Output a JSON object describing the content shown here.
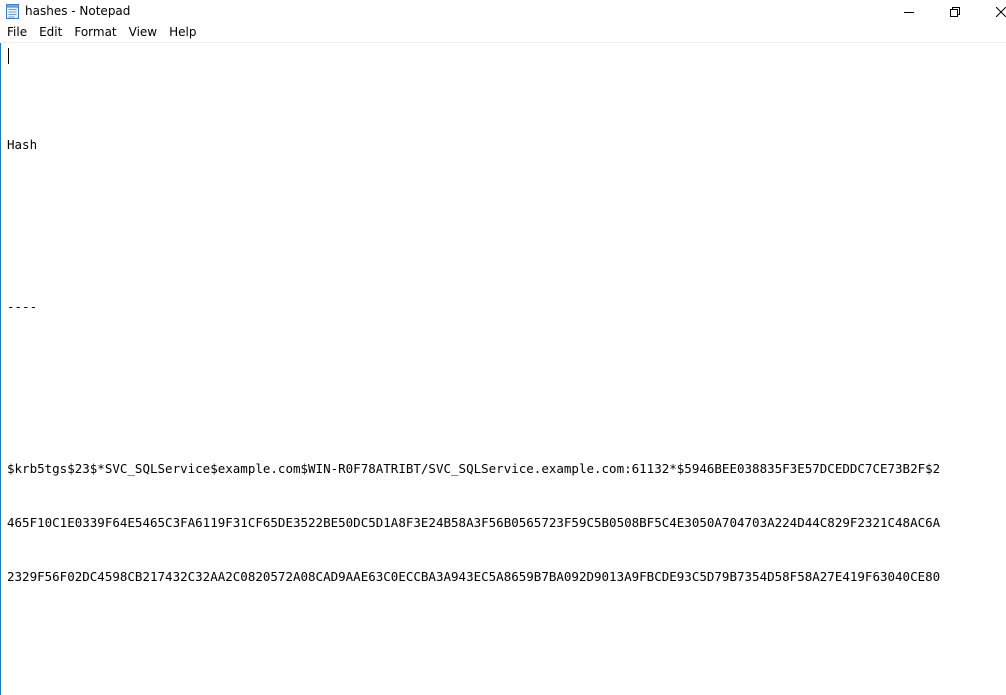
{
  "window": {
    "title": "hashes - Notepad",
    "accent_color": "#1979ca"
  },
  "icons": {
    "app": "notepad-icon",
    "minimize": "minimize-icon",
    "maximize": "restore-icon",
    "close": "close-icon"
  },
  "menu": {
    "items": [
      {
        "label": "File"
      },
      {
        "label": "Edit"
      },
      {
        "label": "Format"
      },
      {
        "label": "View"
      },
      {
        "label": "Help"
      }
    ]
  },
  "editor": {
    "lines": [
      "",
      "Hash",
      "",
      "",
      "----",
      "",
      "",
      "$krb5tgs$23$*SVC_SQLService$example.com$WIN-R0F78ATRIBT/SVC_SQLService.example.com:61132*$5946BEE038835F3E57DCEDDC7CE73B2F$2",
      "465F10C1E0339F64E5465C3FA6119F31CF65DE3522BE50DC5D1A8F3E24B58A3F56B0565723F59C5B0508BF5C4E3050A704703A224D44C829F2321C48AC6A",
      "2329F56F02DC4598CB217432C32AA2C0820572A08CAD9AAE63C0ECCBA3A943EC5A8659B7BA092D9013A9FBCDE93C5D79B7354D58F58A27E419F63040CE80"
    ]
  }
}
